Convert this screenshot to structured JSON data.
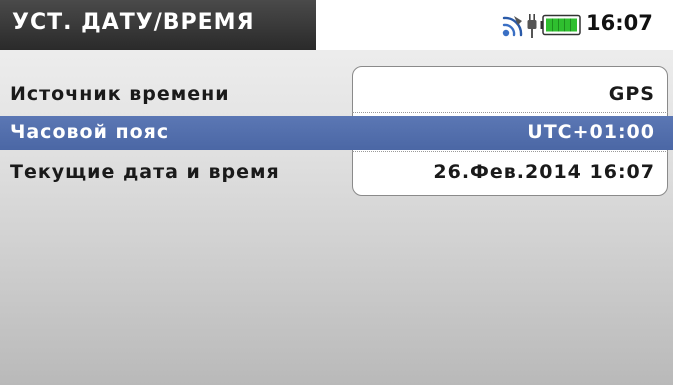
{
  "header": {
    "title": "УСТ. ДАТУ/ВРЕМЯ",
    "clock": "16:07",
    "icons": [
      "gps-signal-icon",
      "power-plug-icon",
      "battery-full-icon"
    ]
  },
  "settings": {
    "rows": [
      {
        "label": "Источник времени",
        "value": "GPS",
        "selected": false
      },
      {
        "label": "Часовой пояс",
        "value": "UTC+01:00",
        "selected": true
      },
      {
        "label": "Текущие дата и время",
        "value": "26.Фев.2014 16:07",
        "selected": false
      }
    ]
  },
  "colors": {
    "title_bar": "#2a2a2a",
    "selection": "#4f6bab",
    "background_top": "#f2f2f2",
    "background_bottom": "#b9b9b9",
    "battery_fill": "#2fbf2f"
  }
}
